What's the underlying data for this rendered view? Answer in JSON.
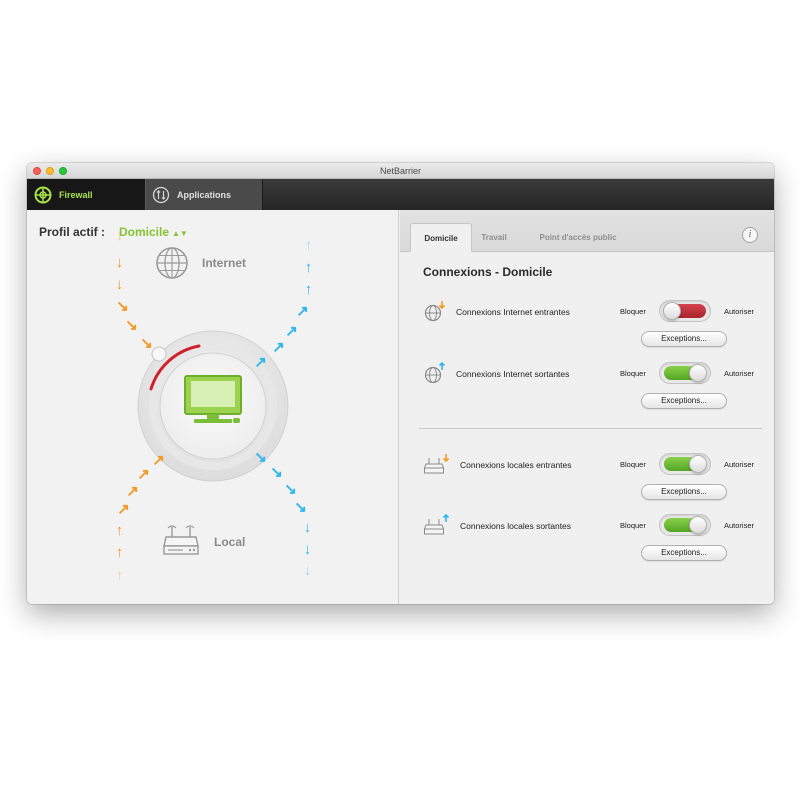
{
  "window": {
    "title": "NetBarrier"
  },
  "toolbar": {
    "firewall_label": "Firewall",
    "applications_label": "Applications"
  },
  "left": {
    "profile_label": "Profil actif :",
    "profile_value": "Domicile",
    "internet_label": "Internet",
    "local_label": "Local"
  },
  "right": {
    "tabs": [
      "Domicile",
      "Travail",
      "Point d'accès public"
    ],
    "info_label": "i",
    "section_title": "Connexions - Domicile",
    "block_label": "Bloquer",
    "allow_label": "Autoriser",
    "exceptions_label": "Exceptions...",
    "rows": [
      {
        "label": "Connexions Internet entrantes",
        "state": "Bloquer",
        "icon": "globe-incoming-icon"
      },
      {
        "label": "Connexions Internet sortantes",
        "state": "Autoriser",
        "icon": "globe-outgoing-icon"
      },
      {
        "label": "Connexions locales entrantes",
        "state": "Autoriser",
        "icon": "router-incoming-icon"
      },
      {
        "label": "Connexions locales sortantes",
        "state": "Autoriser",
        "icon": "router-outgoing-icon"
      }
    ]
  },
  "colors": {
    "accent_green": "#86c232",
    "toggle_blocked": "#c22f38",
    "toggle_allowed": "#6cbe35",
    "incoming_arrow": "#f29a24",
    "outgoing_arrow": "#2fb6ef"
  }
}
